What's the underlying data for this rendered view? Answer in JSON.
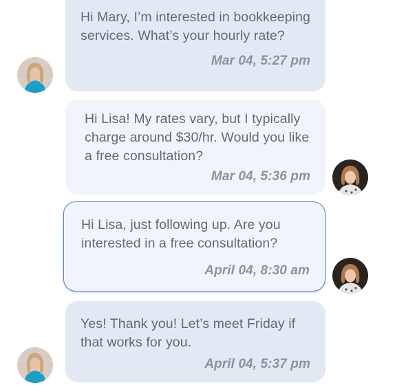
{
  "messages": [
    {
      "sender": "Lisa",
      "direction": "incoming",
      "text": "Hi Mary, I’m interested in bookkeeping services. What’s your hourly rate?",
      "time": "Mar 04, 5:27 pm"
    },
    {
      "sender": "Mary",
      "direction": "outgoing",
      "text": "Hi Lisa! My rates vary, but I typically charge around $30/hr. Would you like a free consultation?",
      "time": "Mar 04, 5:36 pm"
    },
    {
      "sender": "Mary",
      "direction": "outgoing",
      "text": "Hi Lisa, just following up. Are you interested in a free consultation?",
      "time": "April 04, 8:30 am",
      "highlighted": true
    },
    {
      "sender": "Lisa",
      "direction": "incoming",
      "text": "Yes! Thank you! Let’s meet Friday if that works for you.",
      "time": "April 04, 5:37 pm"
    }
  ],
  "colors": {
    "incoming_bubble": "#e3e9f2",
    "outgoing_bubble": "#f1f5fb",
    "highlight_border": "#5a78c9",
    "message_text": "#5f6b78",
    "timestamp_text": "#8a939e"
  },
  "avatars": {
    "lisa": "avatar-photo-blonde-woman-blue-top",
    "mary": "avatar-photo-smiling-woman-dark-background"
  }
}
